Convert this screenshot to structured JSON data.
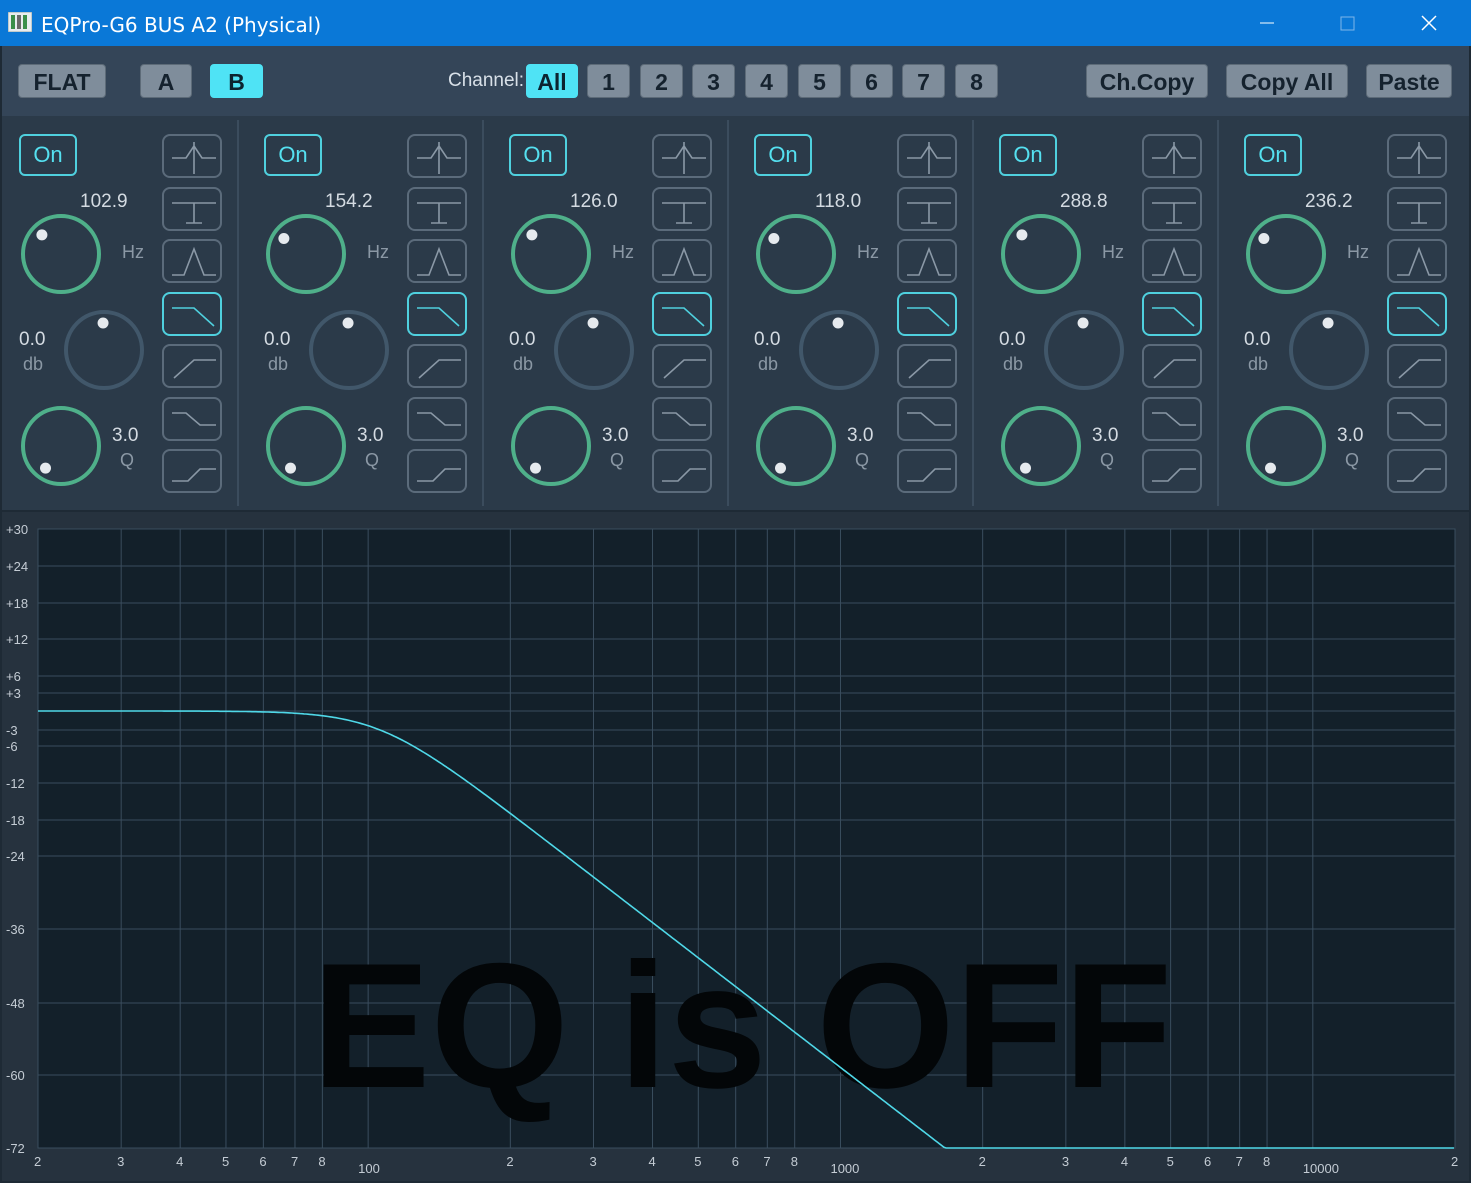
{
  "window": {
    "title": "EQPro-G6 BUS A2 (Physical)",
    "controls": [
      "minimize-icon",
      "maximize-icon",
      "close-icon"
    ]
  },
  "toolbar": {
    "flat_label": "FLAT",
    "a_label": "A",
    "b_label": "B",
    "b_active": true,
    "channel_label": "Channel:",
    "channels": [
      "All",
      "1",
      "2",
      "3",
      "4",
      "5",
      "6",
      "7",
      "8"
    ],
    "channel_active": "All",
    "chcopy_label": "Ch.Copy",
    "copyall_label": "Copy All",
    "paste_label": "Paste"
  },
  "bands": [
    {
      "on_label": "On",
      "freq": "102.9",
      "freq_unit": "Hz",
      "gain": "0.0",
      "gain_unit": "db",
      "q": "3.0",
      "q_unit": "Q",
      "selected_filter": 3
    },
    {
      "on_label": "On",
      "freq": "154.2",
      "freq_unit": "Hz",
      "gain": "0.0",
      "gain_unit": "db",
      "q": "3.0",
      "q_unit": "Q",
      "selected_filter": 3
    },
    {
      "on_label": "On",
      "freq": "126.0",
      "freq_unit": "Hz",
      "gain": "0.0",
      "gain_unit": "db",
      "q": "3.0",
      "q_unit": "Q",
      "selected_filter": 3
    },
    {
      "on_label": "On",
      "freq": "118.0",
      "freq_unit": "Hz",
      "gain": "0.0",
      "gain_unit": "db",
      "q": "3.0",
      "q_unit": "Q",
      "selected_filter": 3
    },
    {
      "on_label": "On",
      "freq": "288.8",
      "freq_unit": "Hz",
      "gain": "0.0",
      "gain_unit": "db",
      "q": "3.0",
      "q_unit": "Q",
      "selected_filter": 3
    },
    {
      "on_label": "On",
      "freq": "236.2",
      "freq_unit": "Hz",
      "gain": "0.0",
      "gain_unit": "db",
      "q": "3.0",
      "q_unit": "Q",
      "selected_filter": 3
    }
  ],
  "filter_types": [
    "notch-filter-icon",
    "low-shelf-cut-icon",
    "peak-filter-icon",
    "low-pass-filter-icon",
    "high-pass-filter-icon",
    "high-shelf-icon",
    "low-shelf-icon"
  ],
  "graph": {
    "overlay_text": "EQ is OFF",
    "y_labels": [
      "+30",
      "+24",
      "+18",
      "+12",
      "+6",
      "+3",
      "-3",
      "-6",
      "-12",
      "-18",
      "-24",
      "-36",
      "-48",
      "-60",
      "-72"
    ],
    "x_labels": [
      "2",
      "3",
      "4",
      "5",
      "6",
      "7",
      "8",
      "100",
      "2",
      "3",
      "4",
      "5",
      "6",
      "7",
      "8",
      "1000",
      "2",
      "3",
      "4",
      "5",
      "6",
      "7",
      "8",
      "10000",
      "2"
    ]
  },
  "colors": {
    "accent": "#4fe3f5",
    "knob_ring": "#4fb08a",
    "curve": "#4fd8e8",
    "title_bar": "#0a78d7"
  }
}
